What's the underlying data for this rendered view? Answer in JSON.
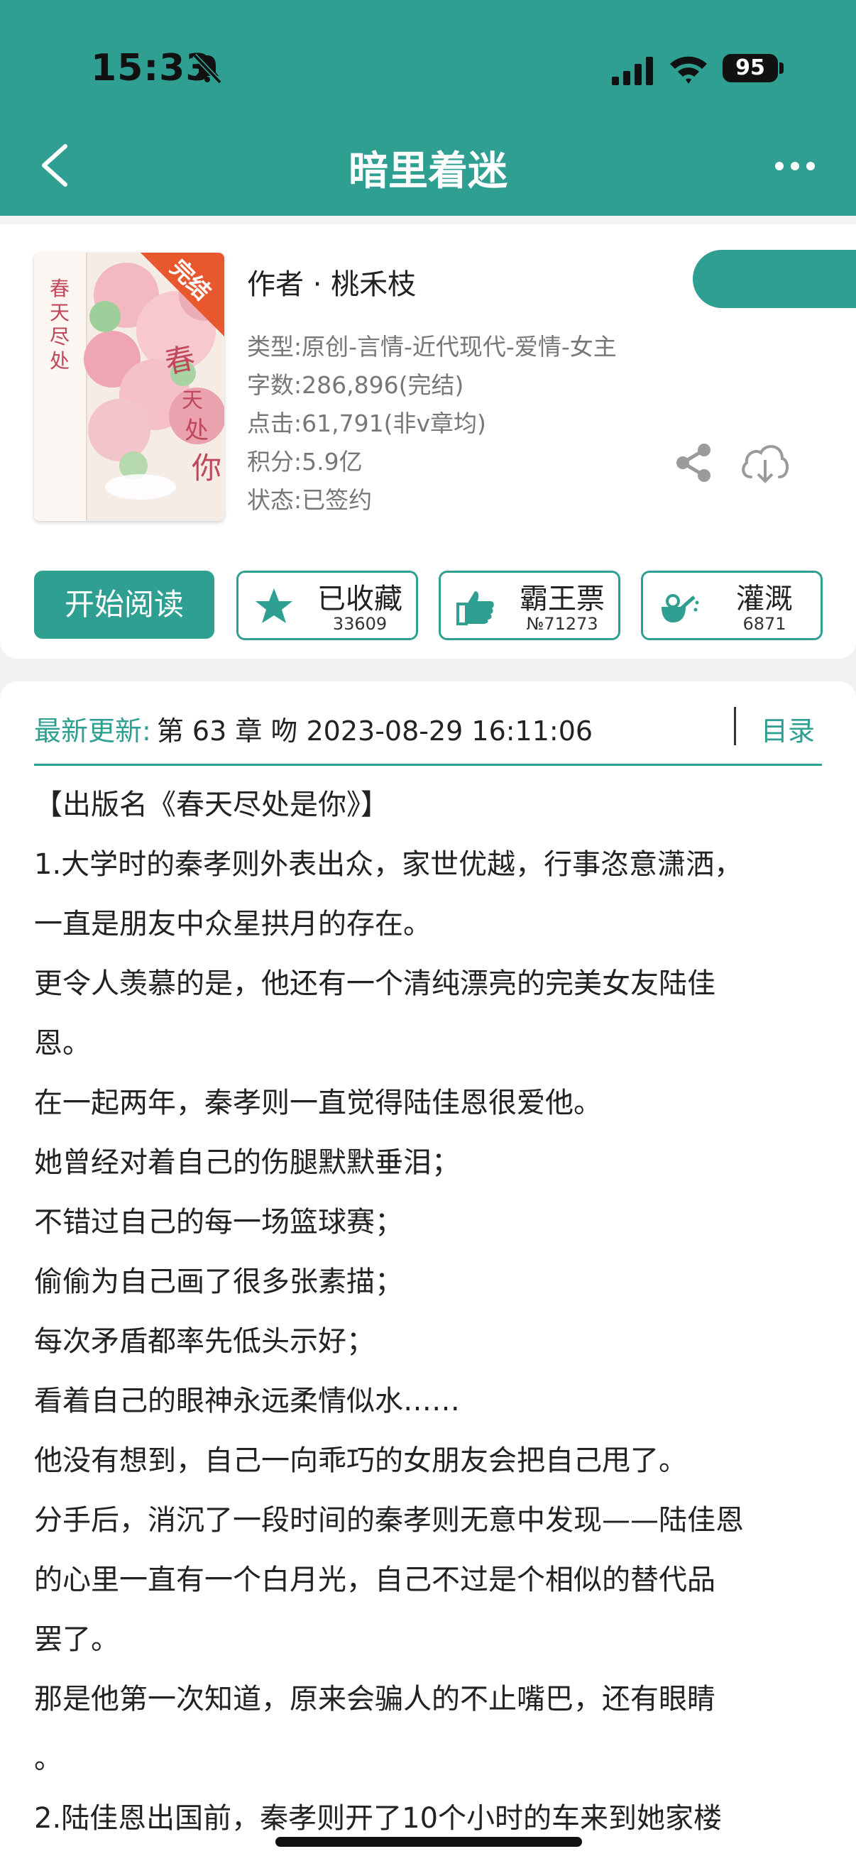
{
  "status_bar": {
    "time": "15:33",
    "battery": "95"
  },
  "header": {
    "title": "暗里着迷"
  },
  "colors": {
    "accent": "#2f9f92"
  },
  "book": {
    "cover_badge": "完结",
    "author": "作者 · 桃禾枝",
    "meta": [
      "类型:原创-言情-近代现代-爱情-女主",
      "字数:286,896(完结)",
      "点击:61,791(非v章均)",
      "积分:5.9亿",
      "状态:已签约"
    ]
  },
  "actions": {
    "read_label": "开始阅读",
    "collect": {
      "label": "已收藏",
      "count": "33609",
      "icon": "star-icon"
    },
    "vote": {
      "label": "霸王票",
      "count": "№71273",
      "icon": "thumbs-up-icon"
    },
    "water": {
      "label": "灌溉",
      "count": "6871",
      "icon": "watering-can-icon"
    }
  },
  "update": {
    "label": "最新更新:",
    "text": "第 63 章 吻 2023-08-29 16:11:06",
    "toc_label": "目录"
  },
  "description": [
    "【出版名《春天尽处是你》】",
    "1.大学时的秦孝则外表出众，家世优越，行事恣意潇洒，",
    "一直是朋友中众星拱月的存在。",
    "更令人羡慕的是，他还有一个清纯漂亮的完美女友陆佳",
    "恩。",
    "在一起两年，秦孝则一直觉得陆佳恩很爱他。",
    "她曾经对着自己的伤腿默默垂泪；",
    "不错过自己的每一场篮球赛；",
    "偷偷为自己画了很多张素描；",
    "每次矛盾都率先低头示好；",
    "看着自己的眼神永远柔情似水……",
    "他没有想到，自己一向乖巧的女朋友会把自己甩了。",
    "分手后，消沉了一段时间的秦孝则无意中发现——陆佳恩",
    "的心里一直有一个白月光，自己不过是个相似的替代品",
    "罢了。",
    "那是他第一次知道，原来会骗人的不止嘴巴，还有眼睛",
    "。",
    "2.陆佳恩出国前，秦孝则开了10个小时的车来到她家楼"
  ]
}
